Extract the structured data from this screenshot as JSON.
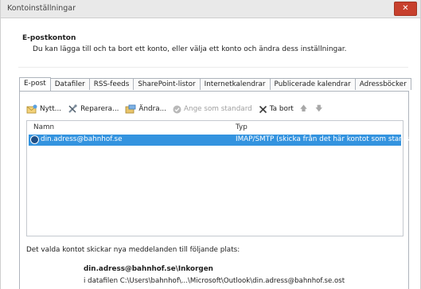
{
  "window": {
    "title": "Kontoinställningar"
  },
  "header": {
    "title": "E-postkonton",
    "description": "Du kan lägga till och ta bort ett konto, eller välja ett konto och ändra dess inställningar."
  },
  "tabs": [
    {
      "label": "E-post",
      "active": true
    },
    {
      "label": "Datafiler"
    },
    {
      "label": "RSS-feeds"
    },
    {
      "label": "SharePoint-listor"
    },
    {
      "label": "Internetkalendrar"
    },
    {
      "label": "Publicerade kalendrar"
    },
    {
      "label": "Adressböcker"
    }
  ],
  "toolbar": {
    "new": "Nytt...",
    "repair": "Reparera...",
    "change": "Ändra...",
    "set_default": "Ange som standard",
    "remove": "Ta bort"
  },
  "list": {
    "columns": {
      "name": "Namn",
      "type": "Typ"
    },
    "rows": [
      {
        "name": "din.adress@bahnhof.se",
        "type": "IMAP/SMTP (skicka från det här kontot som standa..."
      }
    ]
  },
  "footer": {
    "delivery_text": "Det valda kontot skickar nya meddelanden till följande plats:",
    "inbox": "din.adress@bahnhof.se\\Inkorgen",
    "datafile": "i datafilen C:\\Users\\bahnhof\\...\\Microsoft\\Outlook\\din.adress@bahnhof.se.ost"
  },
  "colors": {
    "accent": "#3393df",
    "close": "#c7402d"
  }
}
